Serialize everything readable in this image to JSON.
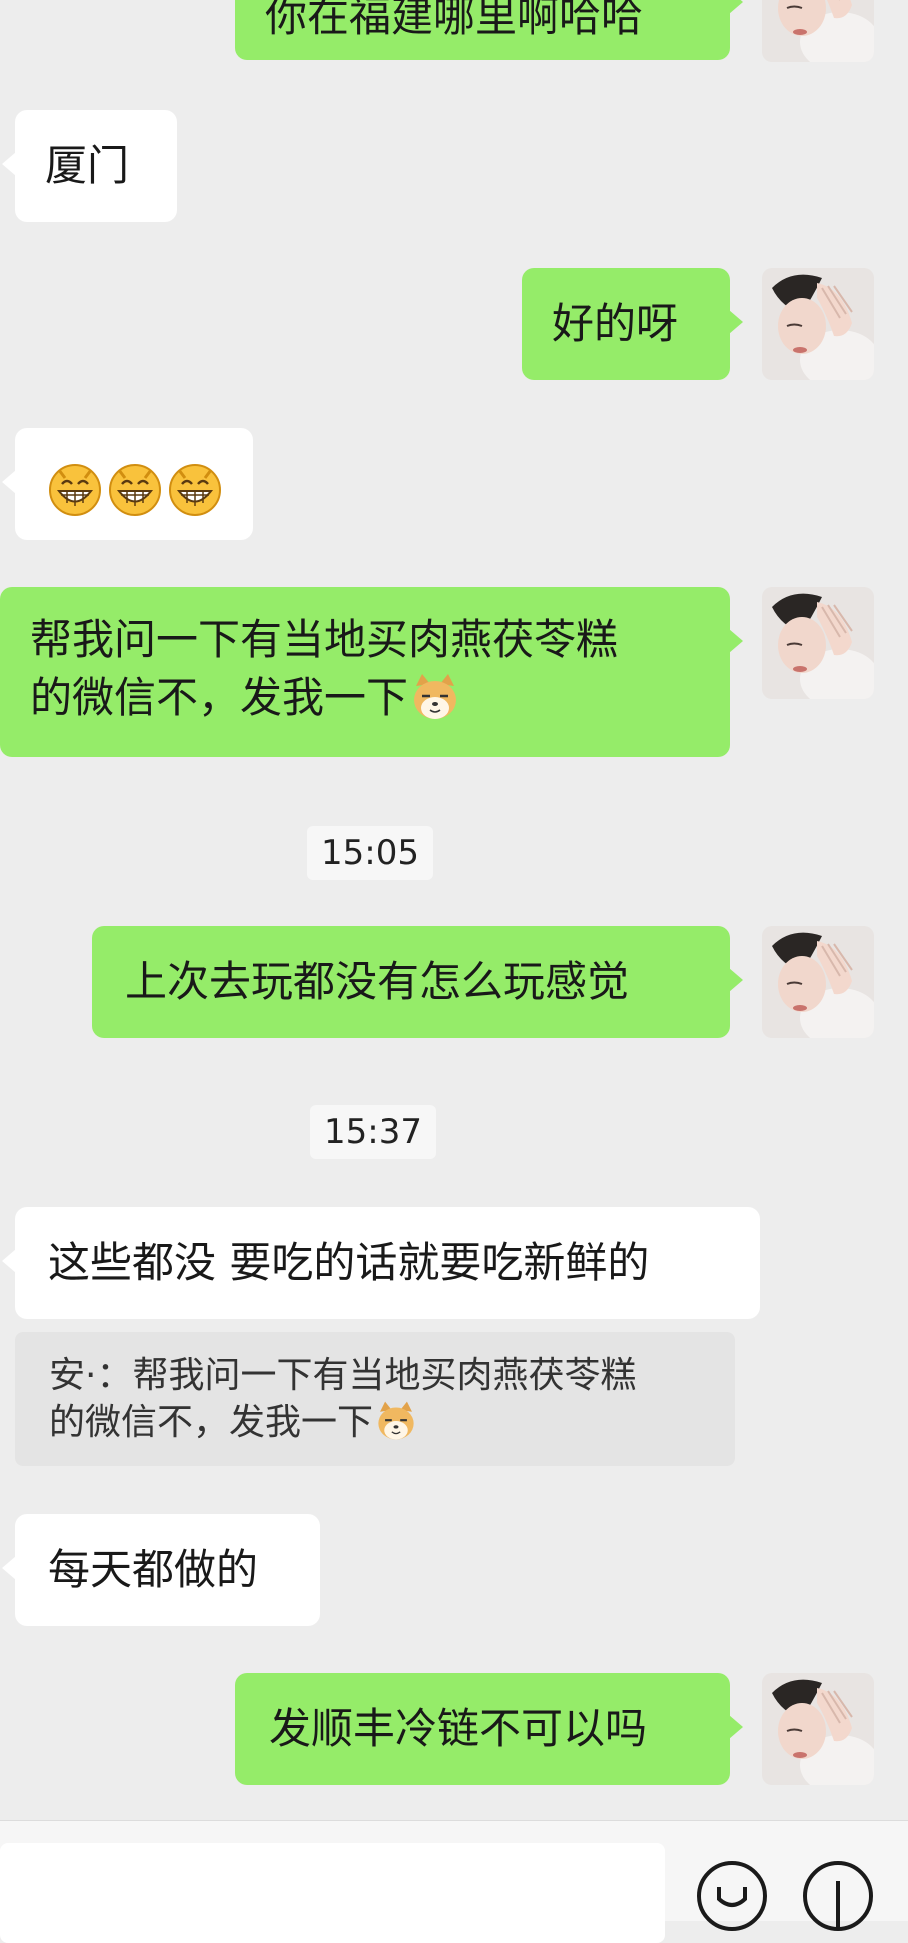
{
  "messages": [
    {
      "id": "m0",
      "side": "right",
      "text": "你在福建哪里啊哈哈"
    },
    {
      "id": "m1",
      "side": "left",
      "text": "厦门"
    },
    {
      "id": "m2",
      "side": "right",
      "text": "好的呀"
    },
    {
      "id": "m3",
      "side": "left",
      "emojis": [
        "grin-emoji",
        "grin-emoji",
        "grin-emoji"
      ]
    },
    {
      "id": "m4",
      "side": "right",
      "lines": [
        "帮我问一下有当地买肉燕茯苓糕",
        "的微信不，发我一下"
      ],
      "trailing_emoji": "doge-emoji"
    },
    {
      "id": "m5",
      "side": "right",
      "text": "上次去玩都没有怎么玩感觉"
    },
    {
      "id": "m6",
      "side": "left",
      "text": "这些都没 要吃的话就要吃新鲜的"
    },
    {
      "id": "m7",
      "side": "left",
      "text": "每天都做的"
    },
    {
      "id": "m8",
      "side": "right",
      "text": "发顺丰冷链不可以吗"
    }
  ],
  "timestamps": [
    "15:05",
    "15:37"
  ],
  "quote": {
    "lines": [
      "安·：帮我问一下有当地买肉燕茯苓糕",
      "的微信不，发我一下"
    ],
    "trailing_emoji": "doge-emoji"
  },
  "colors": {
    "background": "#ededed",
    "sent_bubble": "#95ec69",
    "received_bubble": "#ffffff",
    "quote_bg": "#e4e4e4"
  },
  "input_bar": {
    "icons": [
      "emoji-icon",
      "plus-icon"
    ]
  }
}
